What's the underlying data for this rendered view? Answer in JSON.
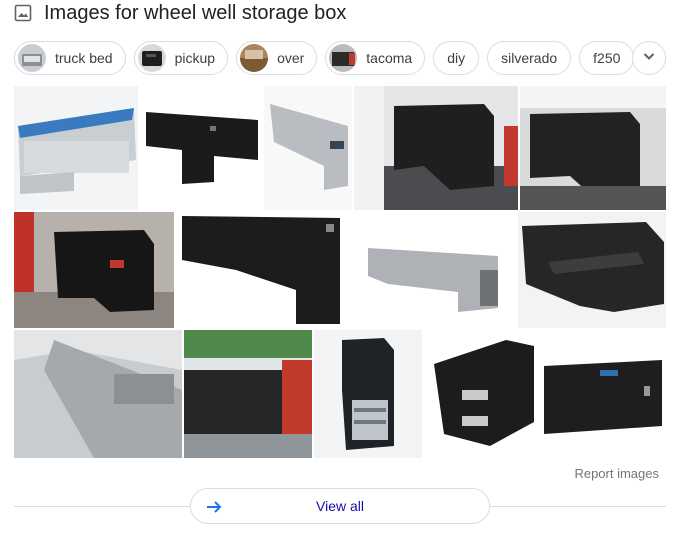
{
  "header": {
    "title": "Images for wheel well storage box",
    "icon": "image-icon"
  },
  "chips": [
    {
      "label": "truck bed",
      "has_thumb": true
    },
    {
      "label": "pickup",
      "has_thumb": true
    },
    {
      "label": "over",
      "has_thumb": true
    },
    {
      "label": "tacoma",
      "has_thumb": true
    },
    {
      "label": "diy",
      "has_thumb": false
    },
    {
      "label": "silverado",
      "has_thumb": false
    },
    {
      "label": "f250",
      "has_thumb": false
    }
  ],
  "more_chips_icon": "chevron-down-icon",
  "report_label": "Report images",
  "view_all": {
    "label": "View all",
    "icon": "arrow-right-icon"
  },
  "colors": {
    "link": "#1a0dab",
    "arrow": "#1a73e8",
    "border": "#dadce0",
    "muted": "#70757a"
  }
}
